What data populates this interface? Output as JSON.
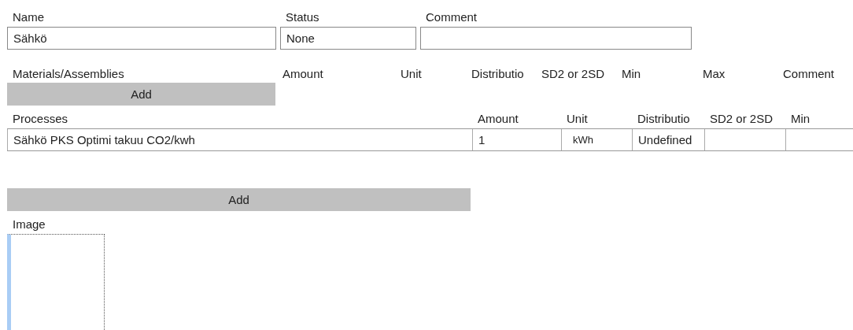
{
  "fields": [
    {
      "label": "Name",
      "value": "Sähkö"
    },
    {
      "label": "Status",
      "value": "None"
    },
    {
      "label": "Comment"
    }
  ],
  "materials": {
    "columns": [
      "Materials/Assemblies",
      "Amount",
      "Unit",
      "Distributio",
      "SD2 or 2SD",
      "Min",
      "Max",
      "Comment"
    ],
    "add_button": "Add"
  },
  "processes": {
    "columns": [
      "Processes",
      "Amount",
      "Unit",
      "Distributio",
      "SD2 or 2SD",
      "Min"
    ],
    "rows": [
      {
        "cells": [
          "Sähkö PKS Optimi takuu CO2/kwh",
          "1",
          "kWh",
          "Undefined"
        ]
      }
    ],
    "add_button": "Add"
  },
  "image": {
    "label": "Image",
    "focused": true
  }
}
